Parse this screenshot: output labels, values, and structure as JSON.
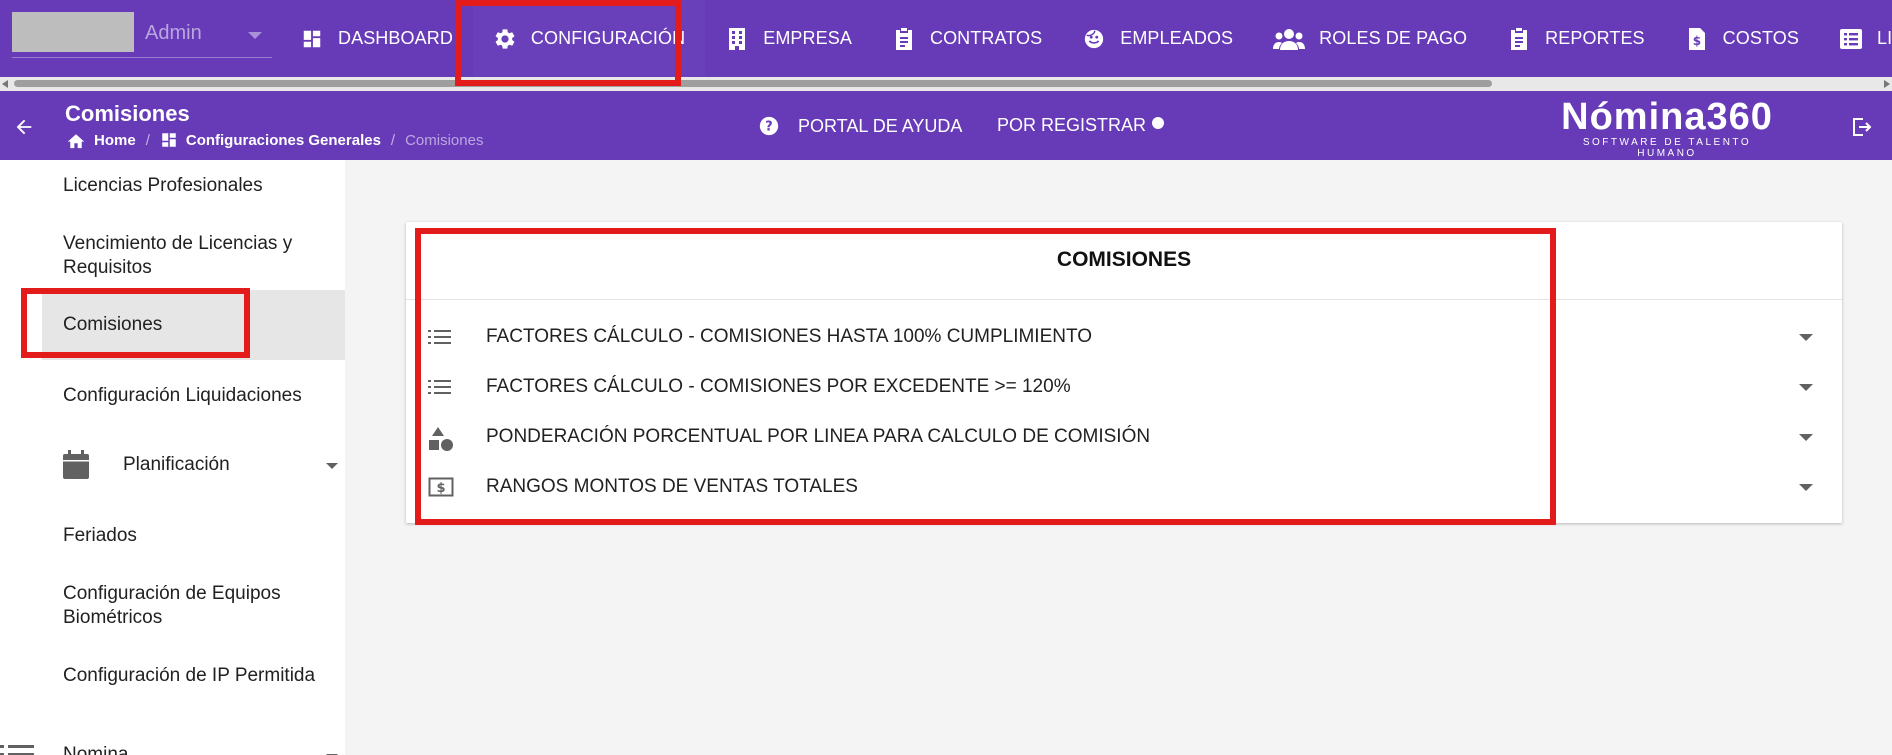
{
  "user": {
    "name": "Admin"
  },
  "nav": {
    "items": [
      {
        "label": "DASHBOARD",
        "icon": "dashboard-icon"
      },
      {
        "label": "CONFIGURACIÓN",
        "icon": "gear-icon"
      },
      {
        "label": "EMPRESA",
        "icon": "building-icon"
      },
      {
        "label": "CONTRATOS",
        "icon": "clipboard-icon"
      },
      {
        "label": "EMPLEADOS",
        "icon": "face-icon"
      },
      {
        "label": "ROLES DE PAGO",
        "icon": "people-icon"
      },
      {
        "label": "REPORTES",
        "icon": "clipboard-list-icon"
      },
      {
        "label": "COSTOS",
        "icon": "dollar-document-icon"
      },
      {
        "label": "LIQUIDACIONE",
        "icon": "list-box-icon"
      }
    ]
  },
  "header": {
    "title": "Comisiones",
    "breadcrumb": {
      "home": "Home",
      "parent": "Configuraciones Generales",
      "current": "Comisiones"
    },
    "help_label": "PORTAL DE AYUDA",
    "register_label": "POR REGISTRAR",
    "brand_name": "Nómina360",
    "brand_tagline": "SOFTWARE DE TALENTO HUMANO"
  },
  "sidebar": {
    "items": [
      {
        "label": "Licencias Profesionales"
      },
      {
        "label": "Vencimiento de Licencias y Requisitos"
      },
      {
        "label": "Comisiones"
      },
      {
        "label": "Configuración Liquidaciones"
      },
      {
        "label": "Planificación",
        "icon": "calendar-icon"
      },
      {
        "label": "Feriados"
      },
      {
        "label": "Configuración de Equipos Biométricos"
      },
      {
        "label": "Configuración de IP Permitida"
      },
      {
        "label": "Nomina",
        "icon": "list-icon"
      }
    ]
  },
  "panel": {
    "title": "COMISIONES",
    "rows": [
      {
        "label": "FACTORES CÁLCULO - COMISIONES HASTA 100% CUMPLIMIENTO",
        "icon": "list-icon"
      },
      {
        "label": "FACTORES CÁLCULO - COMISIONES POR EXCEDENTE >= 120%",
        "icon": "list-icon"
      },
      {
        "label": "PONDERACIÓN PORCENTUAL POR LINEA PARA CALCULO DE COMISIÓN",
        "icon": "shapes-icon"
      },
      {
        "label": "RANGOS MONTOS DE VENTAS TOTALES",
        "icon": "money-icon"
      }
    ]
  },
  "colors": {
    "primary": "#673ab7",
    "highlight": "#e31b1b"
  }
}
